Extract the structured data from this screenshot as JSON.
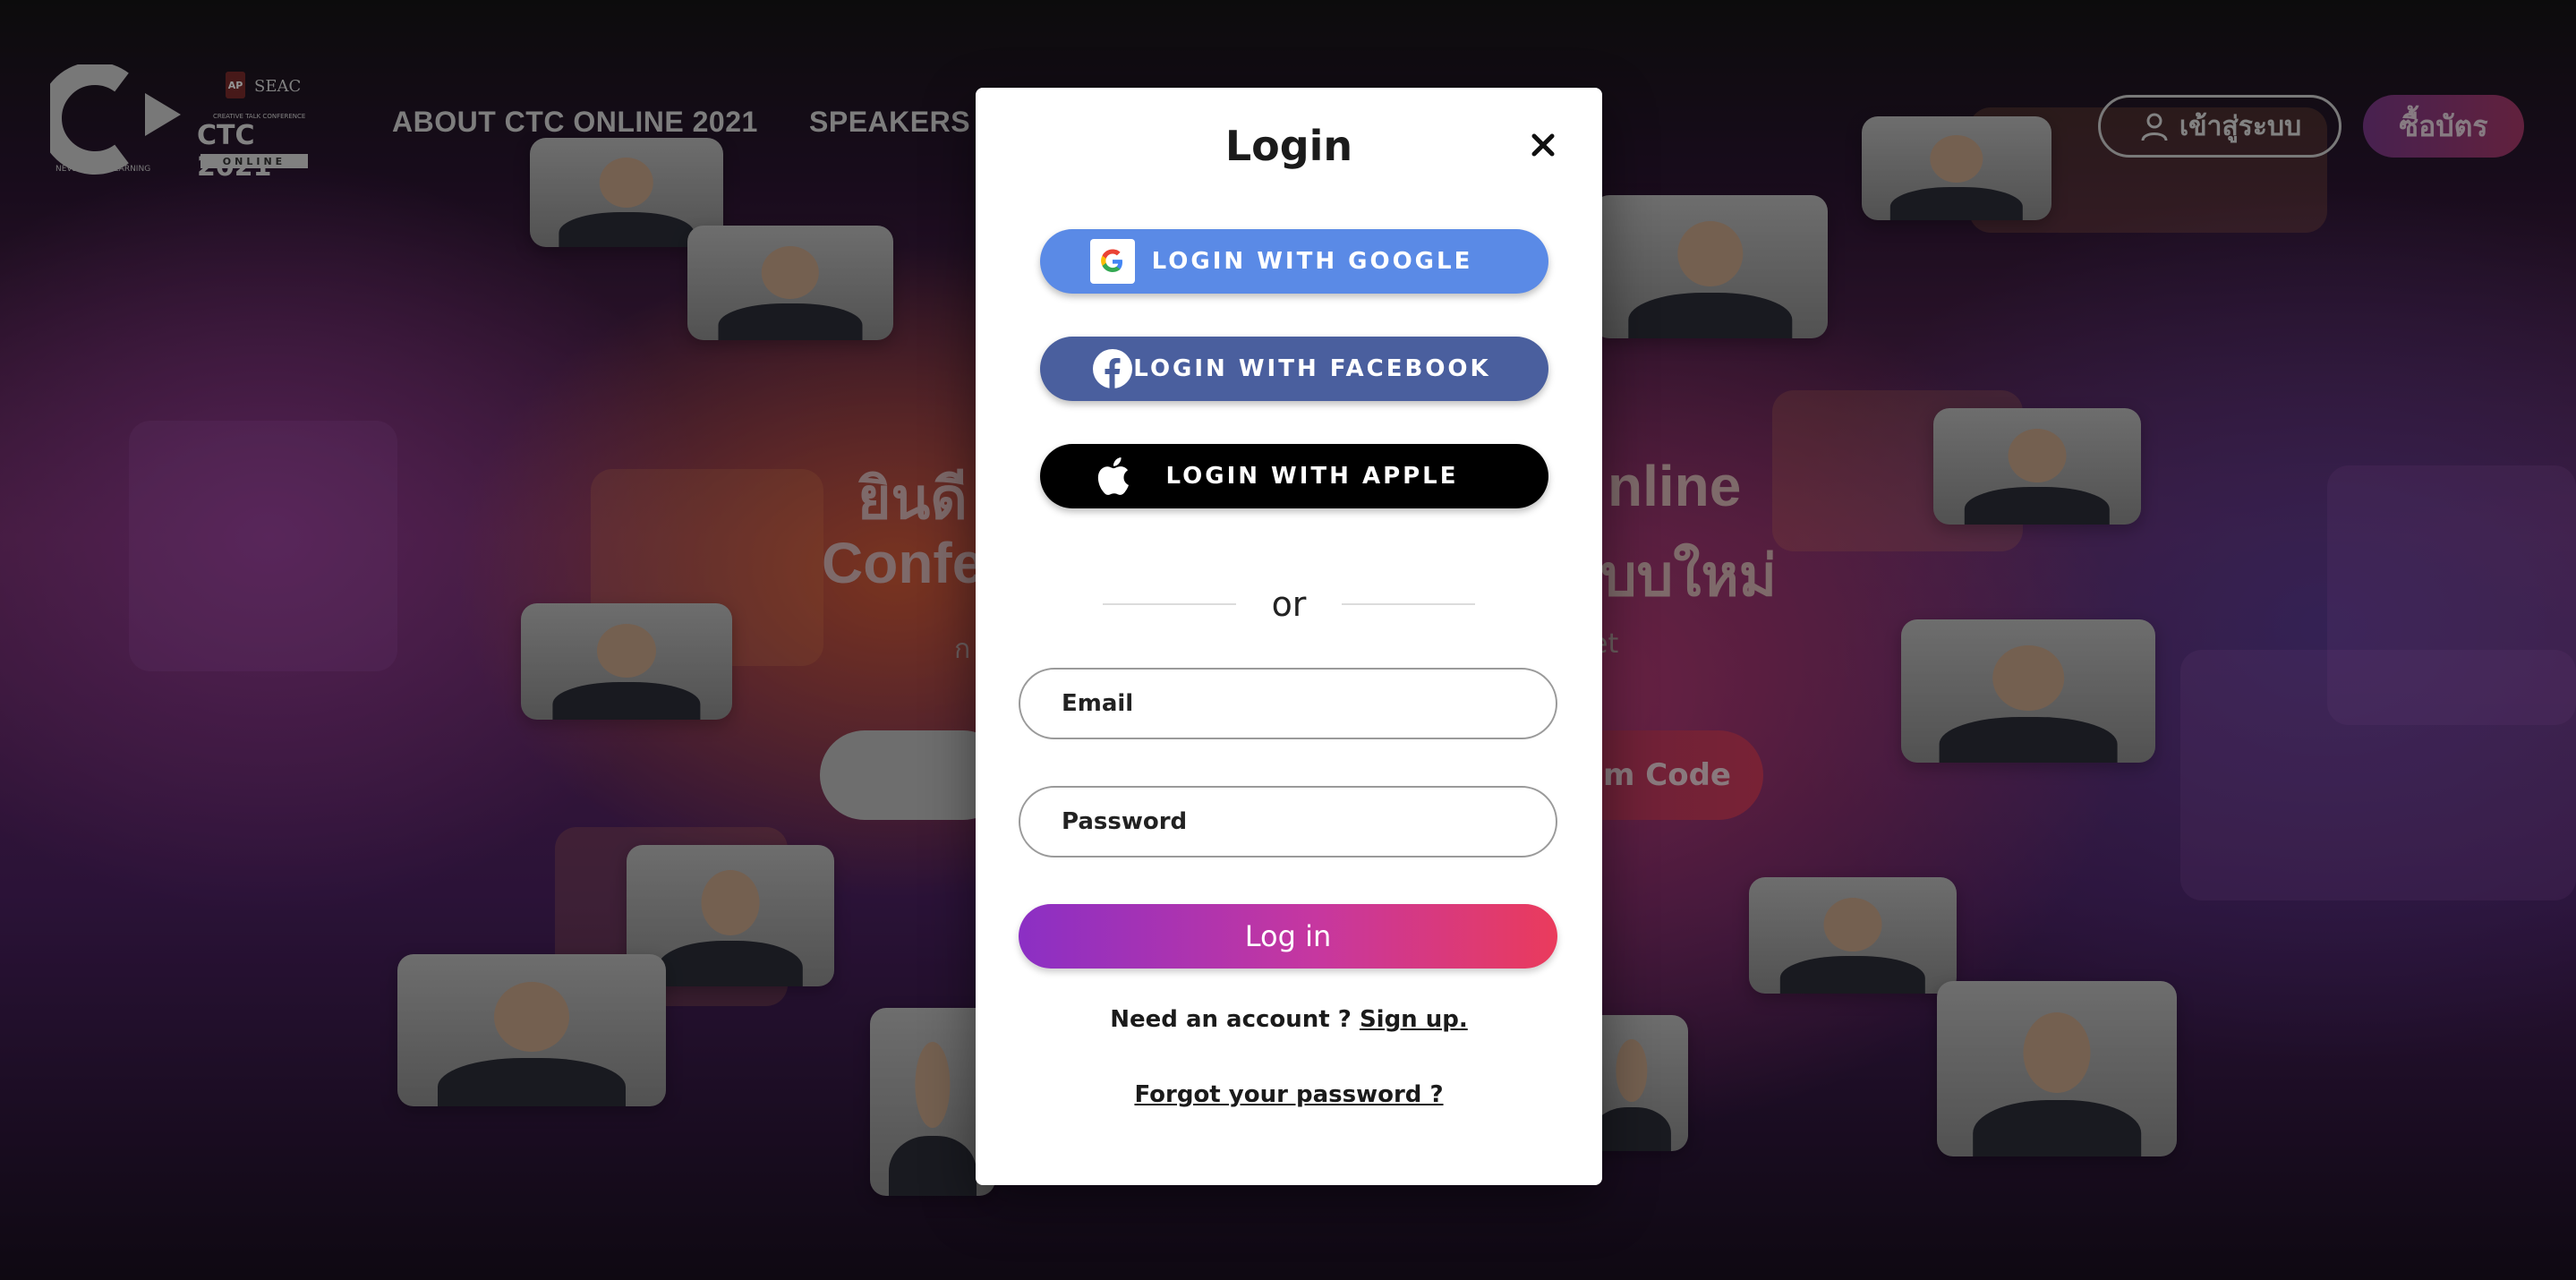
{
  "header": {
    "logo_tagline": "NEVER STOP LEARNING",
    "event_logo": {
      "brand_top": "AP",
      "brand_sub": "SEAC",
      "small_text": "CREATIVE TALK CONFERENCE",
      "name": "CTC 2021",
      "badge": "ONLINE"
    },
    "nav": [
      {
        "label": "ABOUT CTC ONLINE 2021"
      },
      {
        "label": "SPEAKERS"
      }
    ],
    "signin_label": "เข้าสู่ระบบ",
    "buy_label": "ซื้อบัตร"
  },
  "hero": {
    "line1_left": "ยินดี",
    "line1_right": "nline",
    "line2_left": "Confe",
    "line2_right": "บบใหม่",
    "sub_left": "ก",
    "sub_right": "et",
    "redeem_label": "em Code"
  },
  "modal": {
    "title": "Login",
    "close_symbol": "×",
    "google_label": "LOGIN WITH GOOGLE",
    "facebook_label": "LOGIN WITH FACEBOOK",
    "apple_label": "LOGIN WITH APPLE",
    "or_text": "or",
    "email_placeholder": "Email",
    "password_placeholder": "Password",
    "login_button": "Log in",
    "need_account_text": "Need an account ?",
    "signup_link": "Sign up.",
    "forgot_link": "Forgot your password ?"
  },
  "colors": {
    "google": "#5a8ae6",
    "facebook": "#4a5f9e",
    "apple": "#000000",
    "login_gradient_start": "#8b2fc4",
    "login_gradient_end": "#ea3b5c"
  }
}
